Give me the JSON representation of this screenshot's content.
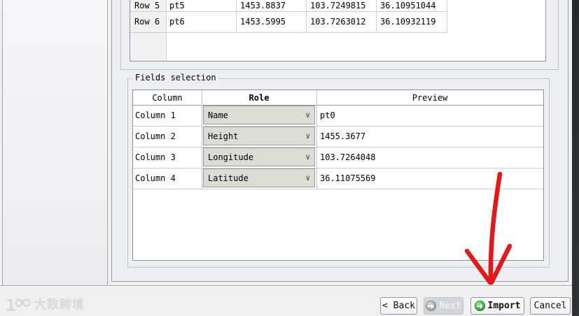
{
  "wizard": {
    "fields_selection_title": "Fields selection",
    "watermark_brand": "大数跨境"
  },
  "preview_table": {
    "rows": [
      {
        "label": "Row 5",
        "name": "pt5",
        "height": "1453.8837",
        "longitude": "103.7249815",
        "latitude": "36.10951044"
      },
      {
        "label": "Row 6",
        "name": "pt6",
        "height": "1453.5995",
        "longitude": "103.7263012",
        "latitude": "36.10932119"
      }
    ]
  },
  "fields_table": {
    "headers": {
      "column": "Column",
      "role": "Role",
      "preview": "Preview"
    },
    "rows": [
      {
        "column": "Column 1",
        "role": "Name",
        "preview": "pt0"
      },
      {
        "column": "Column 2",
        "role": "Height",
        "preview": "1455.3677"
      },
      {
        "column": "Column 3",
        "role": "Longitude",
        "preview": "103.7264048"
      },
      {
        "column": "Column 4",
        "role": "Latitude",
        "preview": "36.11075569"
      }
    ]
  },
  "buttons": {
    "back": "< Back",
    "next": "Next",
    "import": "Import",
    "cancel": "Cancel"
  },
  "icons": {
    "chevron": "∨"
  },
  "annotation": {
    "arrow_color": "#e01a1a"
  },
  "colors": {
    "accent_green": "#2ca335",
    "disabled_button_bg": "#d2d6d9",
    "panel_bg": "#edeff3"
  }
}
